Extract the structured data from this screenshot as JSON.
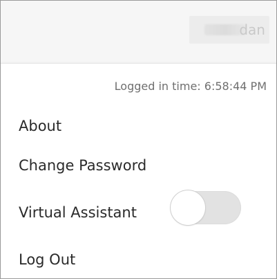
{
  "header": {
    "user_name_visible": "dan"
  },
  "menu": {
    "logged_in_text": "Logged in time: 6:58:44 PM",
    "items": [
      {
        "label": "About"
      },
      {
        "label": "Change Password"
      },
      {
        "label": "Virtual Assistant"
      },
      {
        "label": "Log Out"
      }
    ],
    "virtual_assistant_toggle": {
      "state": "off"
    }
  }
}
